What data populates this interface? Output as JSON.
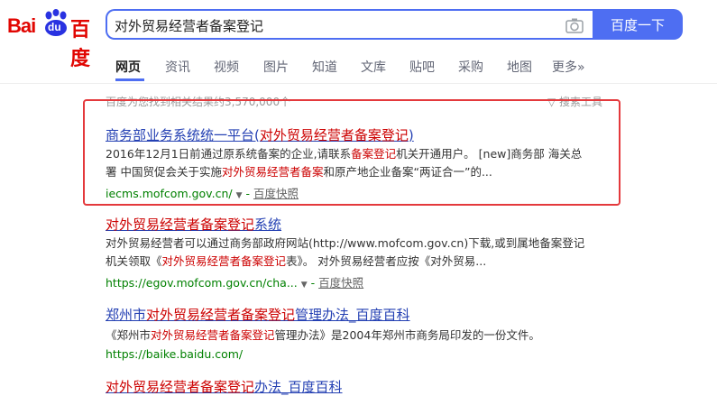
{
  "header": {
    "logo_bai": "Bai",
    "logo_du": "du",
    "logo_cn": "百度",
    "query": "对外贸易经营者备案登记",
    "search_button": "百度一下",
    "camera_icon": "camera-icon"
  },
  "tabs": [
    {
      "label": "网页",
      "active": true
    },
    {
      "label": "资讯"
    },
    {
      "label": "视频"
    },
    {
      "label": "图片"
    },
    {
      "label": "知道"
    },
    {
      "label": "文库"
    },
    {
      "label": "贴吧"
    },
    {
      "label": "采购"
    },
    {
      "label": "地图"
    },
    {
      "label": "更多»"
    }
  ],
  "meta": {
    "result_count": "百度为您找到相关结果约3,570,000个",
    "search_tools": "搜索工具"
  },
  "results": [
    {
      "title_pre": "商务部业务系统统一平台(",
      "title_hl": "对外贸易经营者备案登记",
      "title_post": ")",
      "line1_a": "2016年12月1日前通过原系统备案的企业,请联系",
      "line1_hl": "备案登记",
      "line1_b": "机关开通用户。 [new]商务部 海关总",
      "line2_a": "署 中国贸促会关于实施",
      "line2_hl": "对外贸易经营者备案",
      "line2_b": "和原产地企业备案“两证合一”的...",
      "url": "iecms.mofcom.gov.cn/",
      "cache": "百度快照"
    },
    {
      "title_hl": "对外贸易经营者备案登记",
      "title_post": "系统",
      "line1_a": "对外贸易经营者可以通过商务部政府网站(http://www.mofcom.gov.cn)下载,或到属地备案登记",
      "line2_a": "机关领取《",
      "line2_hl": "对外贸易经营者备案登记",
      "line2_b": "表》。 对外贸易经营者应按《对外贸易...",
      "url": "https://egov.mofcom.gov.cn/cha...",
      "cache": "百度快照"
    },
    {
      "title_pre": "郑州市",
      "title_hl": "对外贸易经营者备案登记",
      "title_post": "管理办法_百度百科",
      "line1_a": "《郑州市",
      "line1_hl": "对外贸易经营者备案登记",
      "line1_b": "管理办法》是2004年郑州市商务局印发的一份文件。",
      "url": "https://baike.baidu.com/"
    },
    {
      "title_hl": "对外贸易经营者备案登记",
      "title_post": "办法_百度百科"
    }
  ]
}
